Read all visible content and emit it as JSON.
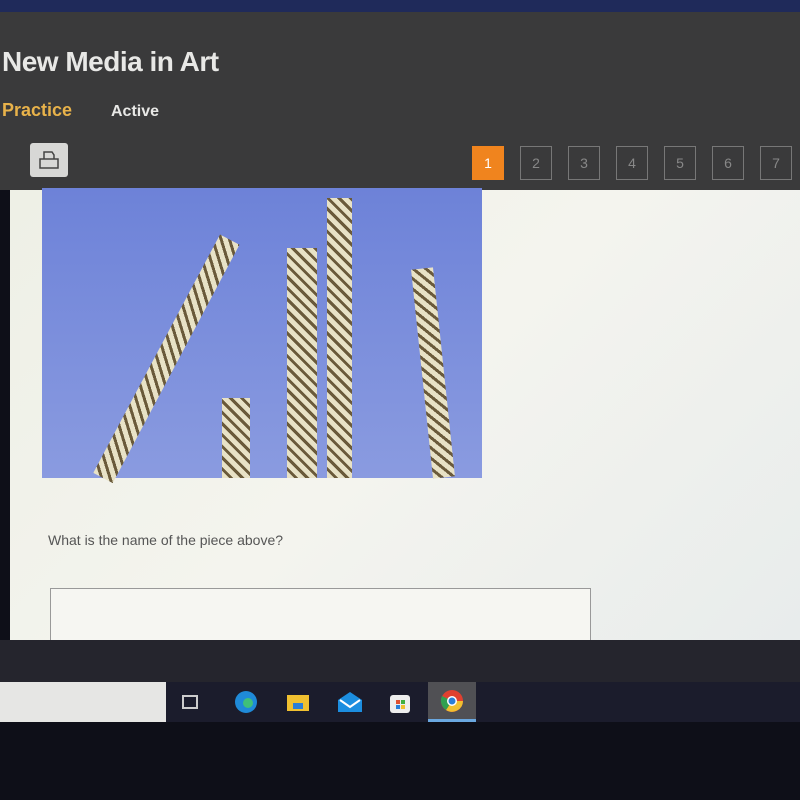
{
  "header": {
    "title": "New Media in Art",
    "tabs": [
      {
        "label": "Practice"
      },
      {
        "label": "Active"
      }
    ]
  },
  "toolbar": {
    "print_icon": "printer-icon"
  },
  "pagination": {
    "current": 1,
    "pages": [
      "1",
      "2",
      "3",
      "4",
      "5",
      "6",
      "7"
    ]
  },
  "question": {
    "text": "What is the name of the piece above?",
    "answer_value": ""
  },
  "taskbar": {
    "icons": [
      "task-view-icon",
      "edge-icon",
      "file-explorer-icon",
      "mail-icon",
      "store-icon",
      "chrome-icon"
    ],
    "active": "chrome-icon"
  },
  "colors": {
    "accent": "#f0841e",
    "practice": "#e8b24a"
  }
}
